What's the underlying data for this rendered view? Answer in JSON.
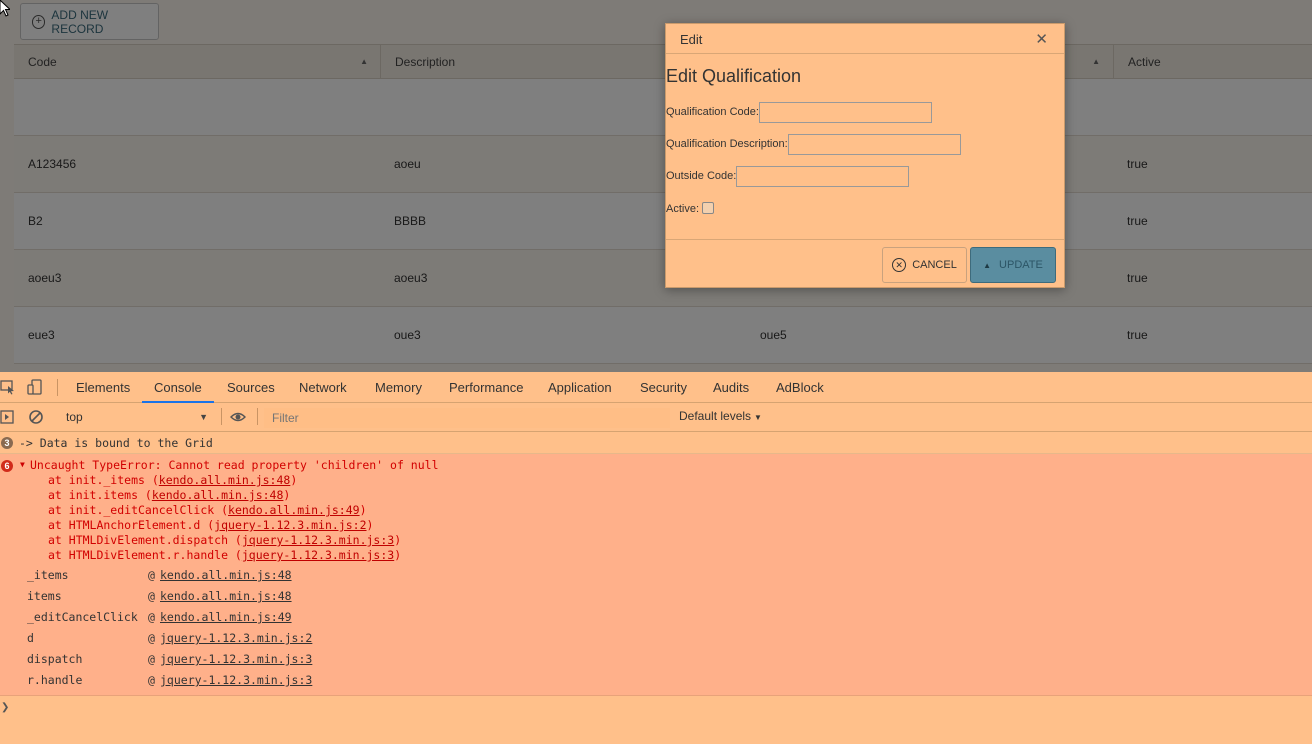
{
  "grid": {
    "add_button_label": "ADD NEW RECORD",
    "columns": [
      {
        "label": "Code",
        "sorted": true
      },
      {
        "label": "Description",
        "sorted": false
      },
      {
        "label": "",
        "sorted": true
      },
      {
        "label": "Active",
        "sorted": false
      }
    ],
    "rows": [
      {
        "code": "",
        "description": "",
        "outside_code": "",
        "active": ""
      },
      {
        "code": "A123456",
        "description": "aoeu",
        "outside_code": "",
        "active": "true"
      },
      {
        "code": "B2",
        "description": "BBBB",
        "outside_code": "",
        "active": "true"
      },
      {
        "code": "aoeu3",
        "description": "aoeu3",
        "outside_code": "",
        "active": "true"
      },
      {
        "code": "eue3",
        "description": "oue3",
        "outside_code": "oue5",
        "active": "true"
      }
    ]
  },
  "modal": {
    "title": "Edit",
    "close_glyph": "✕",
    "heading": "Edit Qualification",
    "fields": {
      "qualification_code_label": "Qualification Code:",
      "qualification_code_value": "",
      "qualification_description_label": "Qualification Description:",
      "qualification_description_value": "",
      "outside_code_label": "Outside Code:",
      "outside_code_value": "",
      "active_label": "Active:",
      "active_checked": false
    },
    "cancel_label": "CANCEL",
    "update_label": "UPDATE"
  },
  "devtools": {
    "tabs": [
      "Elements",
      "Console",
      "Sources",
      "Network",
      "Memory",
      "Performance",
      "Application",
      "Security",
      "Audits",
      "AdBlock"
    ],
    "active_tab": "Console",
    "context": "top",
    "filter_placeholder": "Filter",
    "levels_label": "Default levels",
    "info_count": "3",
    "info_message": "-> Data is bound to the Grid",
    "error_count": "6",
    "error_message": "Uncaught TypeError: Cannot read property 'children' of null",
    "stack": [
      {
        "prefix": "at init._items (",
        "link": "kendo.all.min.js:48",
        "suffix": ")"
      },
      {
        "prefix": "at init.items (",
        "link": "kendo.all.min.js:48",
        "suffix": ")"
      },
      {
        "prefix": "at init._editCancelClick (",
        "link": "kendo.all.min.js:49",
        "suffix": ")"
      },
      {
        "prefix": "at HTMLAnchorElement.d (",
        "link": "jquery-1.12.3.min.js:2",
        "suffix": ")"
      },
      {
        "prefix": "at HTMLDivElement.dispatch (",
        "link": "jquery-1.12.3.min.js:3",
        "suffix": ")"
      },
      {
        "prefix": "at HTMLDivElement.r.handle (",
        "link": "jquery-1.12.3.min.js:3",
        "suffix": ")"
      }
    ],
    "call_stack": [
      {
        "fn": "_items",
        "at": "@",
        "loc": "kendo.all.min.js:48"
      },
      {
        "fn": "items",
        "at": "@",
        "loc": "kendo.all.min.js:48"
      },
      {
        "fn": "_editCancelClick",
        "at": "@",
        "loc": "kendo.all.min.js:49"
      },
      {
        "fn": "d",
        "at": "@",
        "loc": "jquery-1.12.3.min.js:2"
      },
      {
        "fn": "dispatch",
        "at": "@",
        "loc": "jquery-1.12.3.min.js:3"
      },
      {
        "fn": "r.handle",
        "at": "@",
        "loc": "jquery-1.12.3.min.js:3"
      }
    ]
  }
}
